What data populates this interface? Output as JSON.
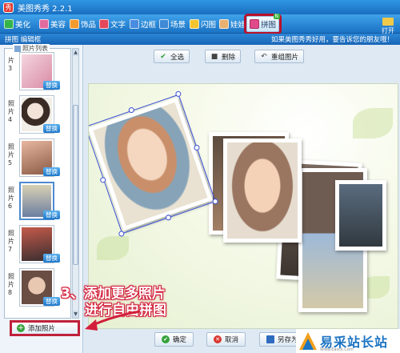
{
  "window": {
    "title": "美图秀秀 2.2.1",
    "app_icon": "秀"
  },
  "tabs": [
    {
      "label": "美化",
      "icon": "beautify-icon",
      "color": "#35b44a"
    },
    {
      "label": "美容",
      "icon": "beauty-icon",
      "color": "#e06aa0"
    },
    {
      "label": "饰品",
      "icon": "accessory-icon",
      "color": "#f29a2e"
    },
    {
      "label": "文字",
      "icon": "text-icon",
      "color": "#e4475a"
    },
    {
      "label": "边框",
      "icon": "border-icon",
      "color": "#4a8de0"
    },
    {
      "label": "场景",
      "icon": "scene-icon",
      "color": "#3e8ad6"
    },
    {
      "label": "闪图",
      "icon": "flash-icon",
      "color": "#f4c430"
    },
    {
      "label": "娃娃",
      "icon": "doll-icon",
      "color": "#e9b070"
    },
    {
      "label": "拼图",
      "icon": "collage-icon",
      "color": "#e04a8a",
      "badge": "N"
    }
  ],
  "open_button": "打开",
  "infobar": {
    "left": "拼图 编辑框",
    "right": "如果美图秀秀好用，要告诉您的朋友哦！"
  },
  "photo_list": {
    "legend": "照片列表",
    "items": [
      {
        "num": "片\n3",
        "replace": "替换",
        "colors": [
          "#f4d6e0",
          "#d98aa4"
        ]
      },
      {
        "num": "照\n片\n4",
        "replace": "替换",
        "colors": [
          "#f2eee8",
          "#3a2b25"
        ]
      },
      {
        "num": "照\n片\n5",
        "replace": "替换",
        "colors": [
          "#e8b7a0",
          "#8a5a45"
        ]
      },
      {
        "num": "照\n片\n6",
        "replace": "替换",
        "colors": [
          "#d9d0b5",
          "#6b7fa0"
        ],
        "selected": true
      },
      {
        "num": "照\n片\n7",
        "replace": "替换",
        "colors": [
          "#c45a4a",
          "#3a2e30"
        ]
      },
      {
        "num": "照\n片\n8",
        "replace": "替换",
        "colors": [
          "#e9c8b2",
          "#6a4e44"
        ]
      }
    ]
  },
  "add_photo": "添加照片",
  "toolbar": {
    "select_all": "全选",
    "delete": "删除",
    "rearrange": "重组图片"
  },
  "annotation": {
    "line1": "3、添加更多照片",
    "line2": "进行自由拼图"
  },
  "bottom": {
    "confirm": "确定",
    "cancel": "取消",
    "save_as": "另存为"
  },
  "watermark": {
    "text": "易采站长站",
    "url": "Www.Easck.Com"
  },
  "colors": {
    "accent_red": "#c0213a",
    "selection_blue": "#3a4fd6",
    "title_blue": "#1a6fc1"
  }
}
